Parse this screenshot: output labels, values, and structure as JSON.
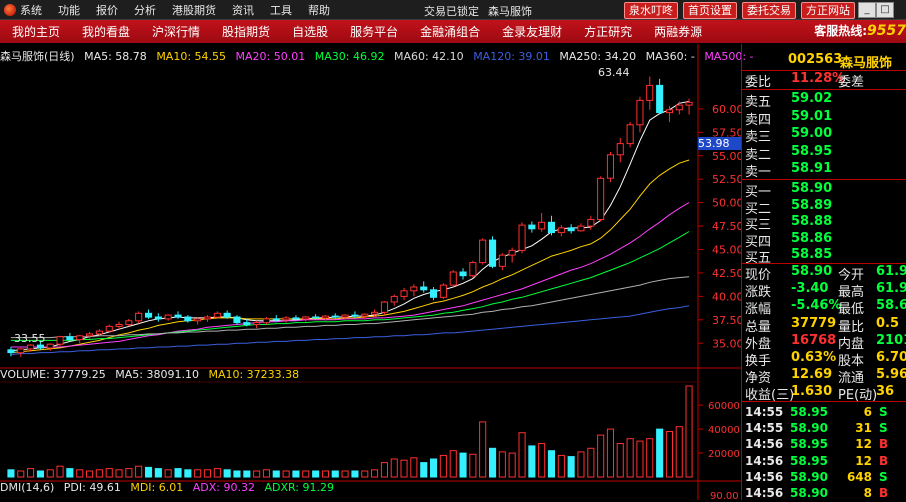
{
  "menu": {
    "items": [
      "系统",
      "功能",
      "报价",
      "分析",
      "港股期货",
      "资讯",
      "工具",
      "帮助"
    ],
    "status": "交易已锁定",
    "stock_name": "森马服饰",
    "buttons": [
      "泉水叮咚",
      "首页设置",
      "委托交易",
      "方正网站"
    ]
  },
  "nav": {
    "items": [
      "我的主页",
      "我的看盘",
      "沪深行情",
      "股指期货",
      "自选股",
      "服务平台",
      "金融涌组合",
      "金录友理财",
      "方正研究",
      "两融券源"
    ],
    "hotline_label": "客服热线:",
    "hotline_number": "9557"
  },
  "ma_bar": {
    "stock": "森马服饰(日线)",
    "ma5": "MA5: 58.78",
    "ma10": "MA10: 54.55",
    "ma20": "MA20: 50.01",
    "ma30": "MA30: 46.92",
    "ma60": "MA60: 42.10",
    "ma120": "MA120: 39.01",
    "ma250": "MA250: 34.20",
    "ma360": "MA360: -",
    "ma500": "MA500: -"
  },
  "vol_bar": {
    "vol": "VOLUME: 37779.25",
    "ma5": "MA5: 38091.10",
    "ma10": "MA10: 37233.38"
  },
  "dmi_bar": {
    "name": "DMI(14,6)",
    "pdi": "PDI: 49.61",
    "mdi": "MDI: 6.01",
    "adx": "ADX: 90.32",
    "adxr": "ADXR: 91.29"
  },
  "annotations": {
    "high": "63.44",
    "low": "33.55",
    "current_price": "53.98"
  },
  "chart_data": {
    "type": "candlestick",
    "yticks": [
      "60.00",
      "57.50",
      "55.00",
      "52.50",
      "50.00",
      "47.50",
      "45.00",
      "42.50",
      "40.00",
      "37.50",
      "35.00"
    ],
    "vol_ticks": [
      "60000",
      "40000",
      "20000"
    ],
    "dmi_tick": "90.00",
    "price_range": [
      33,
      65
    ],
    "current_price": 53.98,
    "volume_max": 76000,
    "candles": [
      [
        34.3,
        34.6,
        33.6,
        34.0
      ],
      [
        34.0,
        34.5,
        33.55,
        34.4
      ],
      [
        34.4,
        34.9,
        34.1,
        34.8
      ],
      [
        34.8,
        35.2,
        34.3,
        34.5
      ],
      [
        34.5,
        35.0,
        34.2,
        34.9
      ],
      [
        34.9,
        35.8,
        34.7,
        35.7
      ],
      [
        35.7,
        36.1,
        35.2,
        35.4
      ],
      [
        35.4,
        35.9,
        35.0,
        35.8
      ],
      [
        35.8,
        36.2,
        35.5,
        36.0
      ],
      [
        36.0,
        36.5,
        35.8,
        36.3
      ],
      [
        36.3,
        37.0,
        36.1,
        36.8
      ],
      [
        36.8,
        37.3,
        36.5,
        37.0
      ],
      [
        37.0,
        37.6,
        36.8,
        37.4
      ],
      [
        37.4,
        38.4,
        37.1,
        38.2
      ],
      [
        38.2,
        38.6,
        37.6,
        37.8
      ],
      [
        37.8,
        38.2,
        37.3,
        37.6
      ],
      [
        37.6,
        38.1,
        37.4,
        38.0
      ],
      [
        38.0,
        38.4,
        37.6,
        37.8
      ],
      [
        37.8,
        38.0,
        37.2,
        37.4
      ],
      [
        37.4,
        37.8,
        37.0,
        37.6
      ],
      [
        37.6,
        38.0,
        37.3,
        37.8
      ],
      [
        37.8,
        38.4,
        37.6,
        38.2
      ],
      [
        38.2,
        38.5,
        37.6,
        37.8
      ],
      [
        37.8,
        38.0,
        37.0,
        37.2
      ],
      [
        37.2,
        37.6,
        36.8,
        37.0
      ],
      [
        37.0,
        37.4,
        36.6,
        37.2
      ],
      [
        37.2,
        37.8,
        37.0,
        37.6
      ],
      [
        37.6,
        38.0,
        37.3,
        37.5
      ],
      [
        37.5,
        37.9,
        37.2,
        37.7
      ],
      [
        37.7,
        38.0,
        37.4,
        37.6
      ],
      [
        37.6,
        37.9,
        37.3,
        37.8
      ],
      [
        37.8,
        38.1,
        37.5,
        37.7
      ],
      [
        37.7,
        38.0,
        37.4,
        37.9
      ],
      [
        37.9,
        38.2,
        37.6,
        37.8
      ],
      [
        37.8,
        38.1,
        37.5,
        38.0
      ],
      [
        38.0,
        38.4,
        37.7,
        37.9
      ],
      [
        37.9,
        38.2,
        37.6,
        38.1
      ],
      [
        38.1,
        38.6,
        37.8,
        38.3
      ],
      [
        38.3,
        39.5,
        38.0,
        39.4
      ],
      [
        39.4,
        40.2,
        39.0,
        40.0
      ],
      [
        40.0,
        40.9,
        39.6,
        40.6
      ],
      [
        40.6,
        41.3,
        40.0,
        41.0
      ],
      [
        41.0,
        41.6,
        40.4,
        40.7
      ],
      [
        40.7,
        41.0,
        39.6,
        39.9
      ],
      [
        39.9,
        41.4,
        39.7,
        41.2
      ],
      [
        41.2,
        42.8,
        41.0,
        42.6
      ],
      [
        42.6,
        43.0,
        41.8,
        42.2
      ],
      [
        42.2,
        43.8,
        42.0,
        43.6
      ],
      [
        43.6,
        46.2,
        43.4,
        46.0
      ],
      [
        46.0,
        46.4,
        43.0,
        43.2
      ],
      [
        43.2,
        44.6,
        42.8,
        44.4
      ],
      [
        44.4,
        45.2,
        43.6,
        44.9
      ],
      [
        44.9,
        47.9,
        44.6,
        47.6
      ],
      [
        47.6,
        48.0,
        46.8,
        47.2
      ],
      [
        47.2,
        48.9,
        46.9,
        47.9
      ],
      [
        47.9,
        48.6,
        46.5,
        46.8
      ],
      [
        46.8,
        47.6,
        46.4,
        47.3
      ],
      [
        47.3,
        47.7,
        46.7,
        47.0
      ],
      [
        47.0,
        47.8,
        46.9,
        47.5
      ],
      [
        47.5,
        48.6,
        47.1,
        48.2
      ],
      [
        48.2,
        52.8,
        48.0,
        52.6
      ],
      [
        52.6,
        55.4,
        52.2,
        55.1
      ],
      [
        55.1,
        56.9,
        54.3,
        56.3
      ],
      [
        56.3,
        58.6,
        55.9,
        58.3
      ],
      [
        58.3,
        61.3,
        57.5,
        60.9
      ],
      [
        60.9,
        63.44,
        59.9,
        62.5
      ],
      [
        62.5,
        63.2,
        59.4,
        59.6
      ],
      [
        59.6,
        60.3,
        58.6,
        59.9
      ],
      [
        59.9,
        60.8,
        59.4,
        60.4
      ],
      [
        60.4,
        61.1,
        59.4,
        60.7
      ]
    ],
    "volumes": [
      6000,
      5000,
      7000,
      5000,
      6000,
      9000,
      7000,
      6000,
      5000,
      6000,
      7000,
      6000,
      7000,
      9000,
      8000,
      7000,
      6000,
      7000,
      6000,
      6000,
      6000,
      7000,
      6000,
      5000,
      5000,
      5000,
      6000,
      5000,
      5000,
      5000,
      5000,
      5000,
      5000,
      5000,
      5000,
      5000,
      5000,
      6000,
      12000,
      15000,
      14000,
      16000,
      12000,
      15000,
      18000,
      22000,
      20000,
      19000,
      46000,
      24000,
      21000,
      20000,
      37000,
      26000,
      28000,
      22000,
      18000,
      17000,
      21000,
      24000,
      35000,
      40000,
      28000,
      32000,
      30000,
      32000,
      40000,
      38000,
      42000,
      76000
    ],
    "ma_lines": [
      {
        "name": "MA5",
        "color": "#ffffff",
        "values": [
          34.2,
          34.3,
          34.4,
          34.5,
          34.6,
          34.9,
          35.2,
          35.4,
          35.7,
          35.9,
          36.2,
          36.5,
          36.8,
          37.1,
          37.4,
          37.6,
          37.7,
          37.8,
          37.7,
          37.7,
          37.7,
          37.8,
          37.8,
          37.7,
          37.5,
          37.4,
          37.4,
          37.4,
          37.4,
          37.5,
          37.6,
          37.7,
          37.7,
          37.8,
          37.8,
          37.9,
          37.9,
          38.0,
          38.3,
          38.7,
          39.2,
          39.8,
          40.2,
          40.5,
          40.7,
          41.0,
          41.4,
          41.9,
          42.9,
          43.7,
          44.2,
          44.6,
          45.0,
          45.4,
          46.1,
          46.9,
          47.2,
          47.3,
          47.3,
          47.4,
          48.1,
          49.7,
          51.7,
          54.1,
          56.6,
          58.8,
          59.5,
          59.9,
          60.6,
          60.8
        ]
      },
      {
        "name": "MA10",
        "color": "#ffd200",
        "values": [
          34.0,
          34.1,
          34.2,
          34.3,
          34.4,
          34.5,
          34.7,
          34.9,
          35.1,
          35.3,
          35.6,
          35.9,
          36.1,
          36.4,
          36.6,
          36.9,
          37.1,
          37.3,
          37.4,
          37.5,
          37.6,
          37.7,
          37.7,
          37.7,
          37.6,
          37.6,
          37.6,
          37.6,
          37.6,
          37.6,
          37.6,
          37.6,
          37.6,
          37.6,
          37.7,
          37.7,
          37.8,
          37.9,
          38.0,
          38.2,
          38.4,
          38.7,
          39.0,
          39.3,
          39.5,
          39.8,
          40.1,
          40.5,
          41.0,
          41.4,
          41.9,
          42.3,
          42.8,
          43.3,
          43.8,
          44.3,
          44.6,
          44.9,
          45.3,
          45.6,
          46.2,
          47.1,
          48.2,
          49.3,
          50.7,
          52.0,
          52.9,
          53.6,
          54.2,
          54.55
        ]
      },
      {
        "name": "MA20",
        "color": "#ff40ff",
        "values": [
          34.6,
          34.6,
          34.6,
          34.6,
          34.6,
          34.6,
          34.7,
          34.8,
          34.9,
          35.0,
          35.1,
          35.2,
          35.4,
          35.6,
          35.8,
          35.9,
          36.1,
          36.3,
          36.4,
          36.5,
          36.7,
          36.8,
          36.9,
          37.0,
          37.1,
          37.2,
          37.3,
          37.3,
          37.4,
          37.4,
          37.5,
          37.5,
          37.5,
          37.5,
          37.6,
          37.6,
          37.6,
          37.7,
          37.7,
          37.8,
          37.9,
          38.0,
          38.2,
          38.4,
          38.6,
          38.8,
          39.0,
          39.3,
          39.6,
          39.9,
          40.2,
          40.5,
          40.8,
          41.2,
          41.6,
          42.0,
          42.4,
          42.8,
          43.1,
          43.5,
          44.0,
          44.5,
          45.1,
          45.7,
          46.4,
          47.2,
          47.9,
          48.7,
          49.4,
          50.01
        ]
      },
      {
        "name": "MA30",
        "color": "#00ff3c",
        "values": [
          35.3,
          35.3,
          35.3,
          35.3,
          35.3,
          35.3,
          35.3,
          35.4,
          35.4,
          35.5,
          35.5,
          35.6,
          35.7,
          35.8,
          35.9,
          36.0,
          36.1,
          36.2,
          36.3,
          36.4,
          36.5,
          36.6,
          36.7,
          36.8,
          36.9,
          37.0,
          37.0,
          37.1,
          37.1,
          37.2,
          37.2,
          37.3,
          37.3,
          37.3,
          37.4,
          37.4,
          37.4,
          37.5,
          37.5,
          37.6,
          37.7,
          37.8,
          37.9,
          38.0,
          38.2,
          38.3,
          38.5,
          38.7,
          38.9,
          39.2,
          39.4,
          39.7,
          39.9,
          40.2,
          40.5,
          40.8,
          41.1,
          41.4,
          41.7,
          42.0,
          42.4,
          42.8,
          43.2,
          43.6,
          44.1,
          44.6,
          45.1,
          45.7,
          46.3,
          46.92
        ]
      },
      {
        "name": "MA60",
        "color": "#b0b0b0",
        "values": [
          35.6,
          35.6,
          35.6,
          35.6,
          35.6,
          35.7,
          35.7,
          35.7,
          35.7,
          35.8,
          35.8,
          35.8,
          35.9,
          35.9,
          36.0,
          36.0,
          36.1,
          36.1,
          36.2,
          36.2,
          36.3,
          36.3,
          36.4,
          36.4,
          36.5,
          36.5,
          36.6,
          36.6,
          36.7,
          36.7,
          36.8,
          36.8,
          36.9,
          36.9,
          37.0,
          37.0,
          37.1,
          37.1,
          37.2,
          37.3,
          37.4,
          37.5,
          37.6,
          37.7,
          37.8,
          37.9,
          38.0,
          38.1,
          38.3,
          38.4,
          38.6,
          38.7,
          38.9,
          39.0,
          39.2,
          39.4,
          39.6,
          39.8,
          40.0,
          40.2,
          40.4,
          40.6,
          40.8,
          41.0,
          41.2,
          41.5,
          41.7,
          41.9,
          42.0,
          42.1
        ]
      },
      {
        "name": "MA120",
        "color": "#3a5fe0",
        "values": [
          33.8,
          33.9,
          33.9,
          34.0,
          34.0,
          34.1,
          34.1,
          34.2,
          34.2,
          34.3,
          34.3,
          34.4,
          34.4,
          34.5,
          34.5,
          34.6,
          34.6,
          34.7,
          34.7,
          34.8,
          34.8,
          34.9,
          34.9,
          35.0,
          35.0,
          35.1,
          35.1,
          35.2,
          35.2,
          35.3,
          35.3,
          35.4,
          35.4,
          35.5,
          35.5,
          35.6,
          35.6,
          35.7,
          35.7,
          35.8,
          35.8,
          35.9,
          35.9,
          36.0,
          36.1,
          36.1,
          36.2,
          36.3,
          36.4,
          36.5,
          36.6,
          36.7,
          36.8,
          36.9,
          37.0,
          37.1,
          37.2,
          37.3,
          37.4,
          37.5,
          37.6,
          37.7,
          37.8,
          37.9,
          38.1,
          38.3,
          38.5,
          38.7,
          38.8,
          39.01
        ]
      }
    ]
  },
  "right_panel": {
    "code": "002563",
    "name": "森马服饰",
    "wb_label": "委比",
    "wb_value": "11.28%",
    "wc_label": "委差",
    "sells": [
      {
        "label": "卖五",
        "price": "59.02"
      },
      {
        "label": "卖四",
        "price": "59.01"
      },
      {
        "label": "卖三",
        "price": "59.00"
      },
      {
        "label": "卖二",
        "price": "58.95"
      },
      {
        "label": "卖一",
        "price": "58.91"
      }
    ],
    "buys": [
      {
        "label": "买一",
        "price": "58.90"
      },
      {
        "label": "买二",
        "price": "58.89"
      },
      {
        "label": "买三",
        "price": "58.88"
      },
      {
        "label": "买四",
        "price": "58.86"
      },
      {
        "label": "买五",
        "price": "58.85"
      }
    ],
    "stats": [
      {
        "l1": "现价",
        "v1": "58.90",
        "c1": "#00ff3c",
        "l2": "今开",
        "v2": "61.9",
        "c2": "#00ff3c"
      },
      {
        "l1": "涨跌",
        "v1": "-3.40",
        "c1": "#00ff3c",
        "l2": "最高",
        "v2": "61.9",
        "c2": "#00ff3c"
      },
      {
        "l1": "涨幅",
        "v1": "-5.46%",
        "c1": "#00ff3c",
        "l2": "最低",
        "v2": "58.6",
        "c2": "#00ff3c"
      },
      {
        "l1": "总量",
        "v1": "37779",
        "c1": "#ffd200",
        "l2": "量比",
        "v2": "0.5",
        "c2": "#ffd200"
      },
      {
        "l1": "外盘",
        "v1": "16768",
        "c1": "#ff3030",
        "l2": "内盘",
        "v2": "2101",
        "c2": "#00ff3c"
      },
      {
        "l1": "换手",
        "v1": "0.63%",
        "c1": "#ffd200",
        "l2": "股本",
        "v2": "6.70",
        "c2": "#ffd200"
      },
      {
        "l1": "净资",
        "v1": "12.69",
        "c1": "#ffd200",
        "l2": "流通",
        "v2": "5.96",
        "c2": "#ffd200"
      },
      {
        "l1": "收益(三)",
        "v1": "1.630",
        "c1": "#ffd200",
        "l2": "PE(动)",
        "v2": "36",
        "c2": "#ffd200"
      }
    ],
    "ticks": [
      {
        "time": "14:55",
        "price": "58.95",
        "qty": "6",
        "side": "S",
        "side_color": "#00ff3c"
      },
      {
        "time": "14:55",
        "price": "58.90",
        "qty": "31",
        "side": "S",
        "side_color": "#00ff3c"
      },
      {
        "time": "14:56",
        "price": "58.95",
        "qty": "12",
        "side": "B",
        "side_color": "#ff3030"
      },
      {
        "time": "14:56",
        "price": "58.95",
        "qty": "12",
        "side": "B",
        "side_color": "#ff3030"
      },
      {
        "time": "14:56",
        "price": "58.90",
        "qty": "648",
        "side": "S",
        "side_color": "#00ff3c"
      },
      {
        "time": "14:56",
        "price": "58.90",
        "qty": "8",
        "side": "B",
        "side_color": "#ff3030"
      }
    ]
  }
}
